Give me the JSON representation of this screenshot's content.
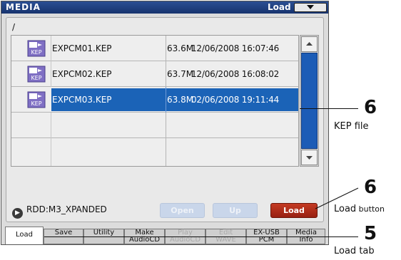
{
  "window": {
    "title": "MEDIA",
    "page_label": "Load"
  },
  "path": "/",
  "files": [
    {
      "name": "EXPCM01.KEP",
      "size": "63.6M",
      "date": "12/06/2008 16:07:46",
      "selected": false
    },
    {
      "name": "EXPCM02.KEP",
      "size": "63.7M",
      "date": "12/06/2008 16:08:02",
      "selected": false
    },
    {
      "name": "EXPCM03.KEP",
      "size": "63.8M",
      "date": "02/06/2008 19:11:44",
      "selected": true
    }
  ],
  "icon_label": "KEP",
  "drive": "RDD:M3_XPANDED",
  "buttons": {
    "open": "Open",
    "up": "Up",
    "load": "Load"
  },
  "tabs": [
    {
      "line1": "Load",
      "line2": "",
      "active": true,
      "dim": false
    },
    {
      "line1": "Save",
      "line2": "",
      "active": false,
      "dim": false
    },
    {
      "line1": "Utility",
      "line2": "",
      "active": false,
      "dim": false
    },
    {
      "line1": "Make",
      "line2": "AudioCD",
      "active": false,
      "dim": false
    },
    {
      "line1": "Play",
      "line2": "AudioCD",
      "active": false,
      "dim": true
    },
    {
      "line1": "Edit",
      "line2": "WAVE",
      "active": false,
      "dim": true
    },
    {
      "line1": "EX-USB",
      "line2": "PCM",
      "active": false,
      "dim": false
    },
    {
      "line1": "Media",
      "line2": "Info",
      "active": false,
      "dim": false
    }
  ],
  "callouts": {
    "kep_file": {
      "number": "6",
      "text": "KEP file"
    },
    "load_button": {
      "number": "6",
      "text_bold": "Load",
      "text_rest": " button"
    },
    "load_tab": {
      "number": "5",
      "text": "Load tab"
    }
  },
  "colors": {
    "title_bar": "#17336e",
    "selection": "#1b63b7",
    "load_button": "#b02c18"
  }
}
